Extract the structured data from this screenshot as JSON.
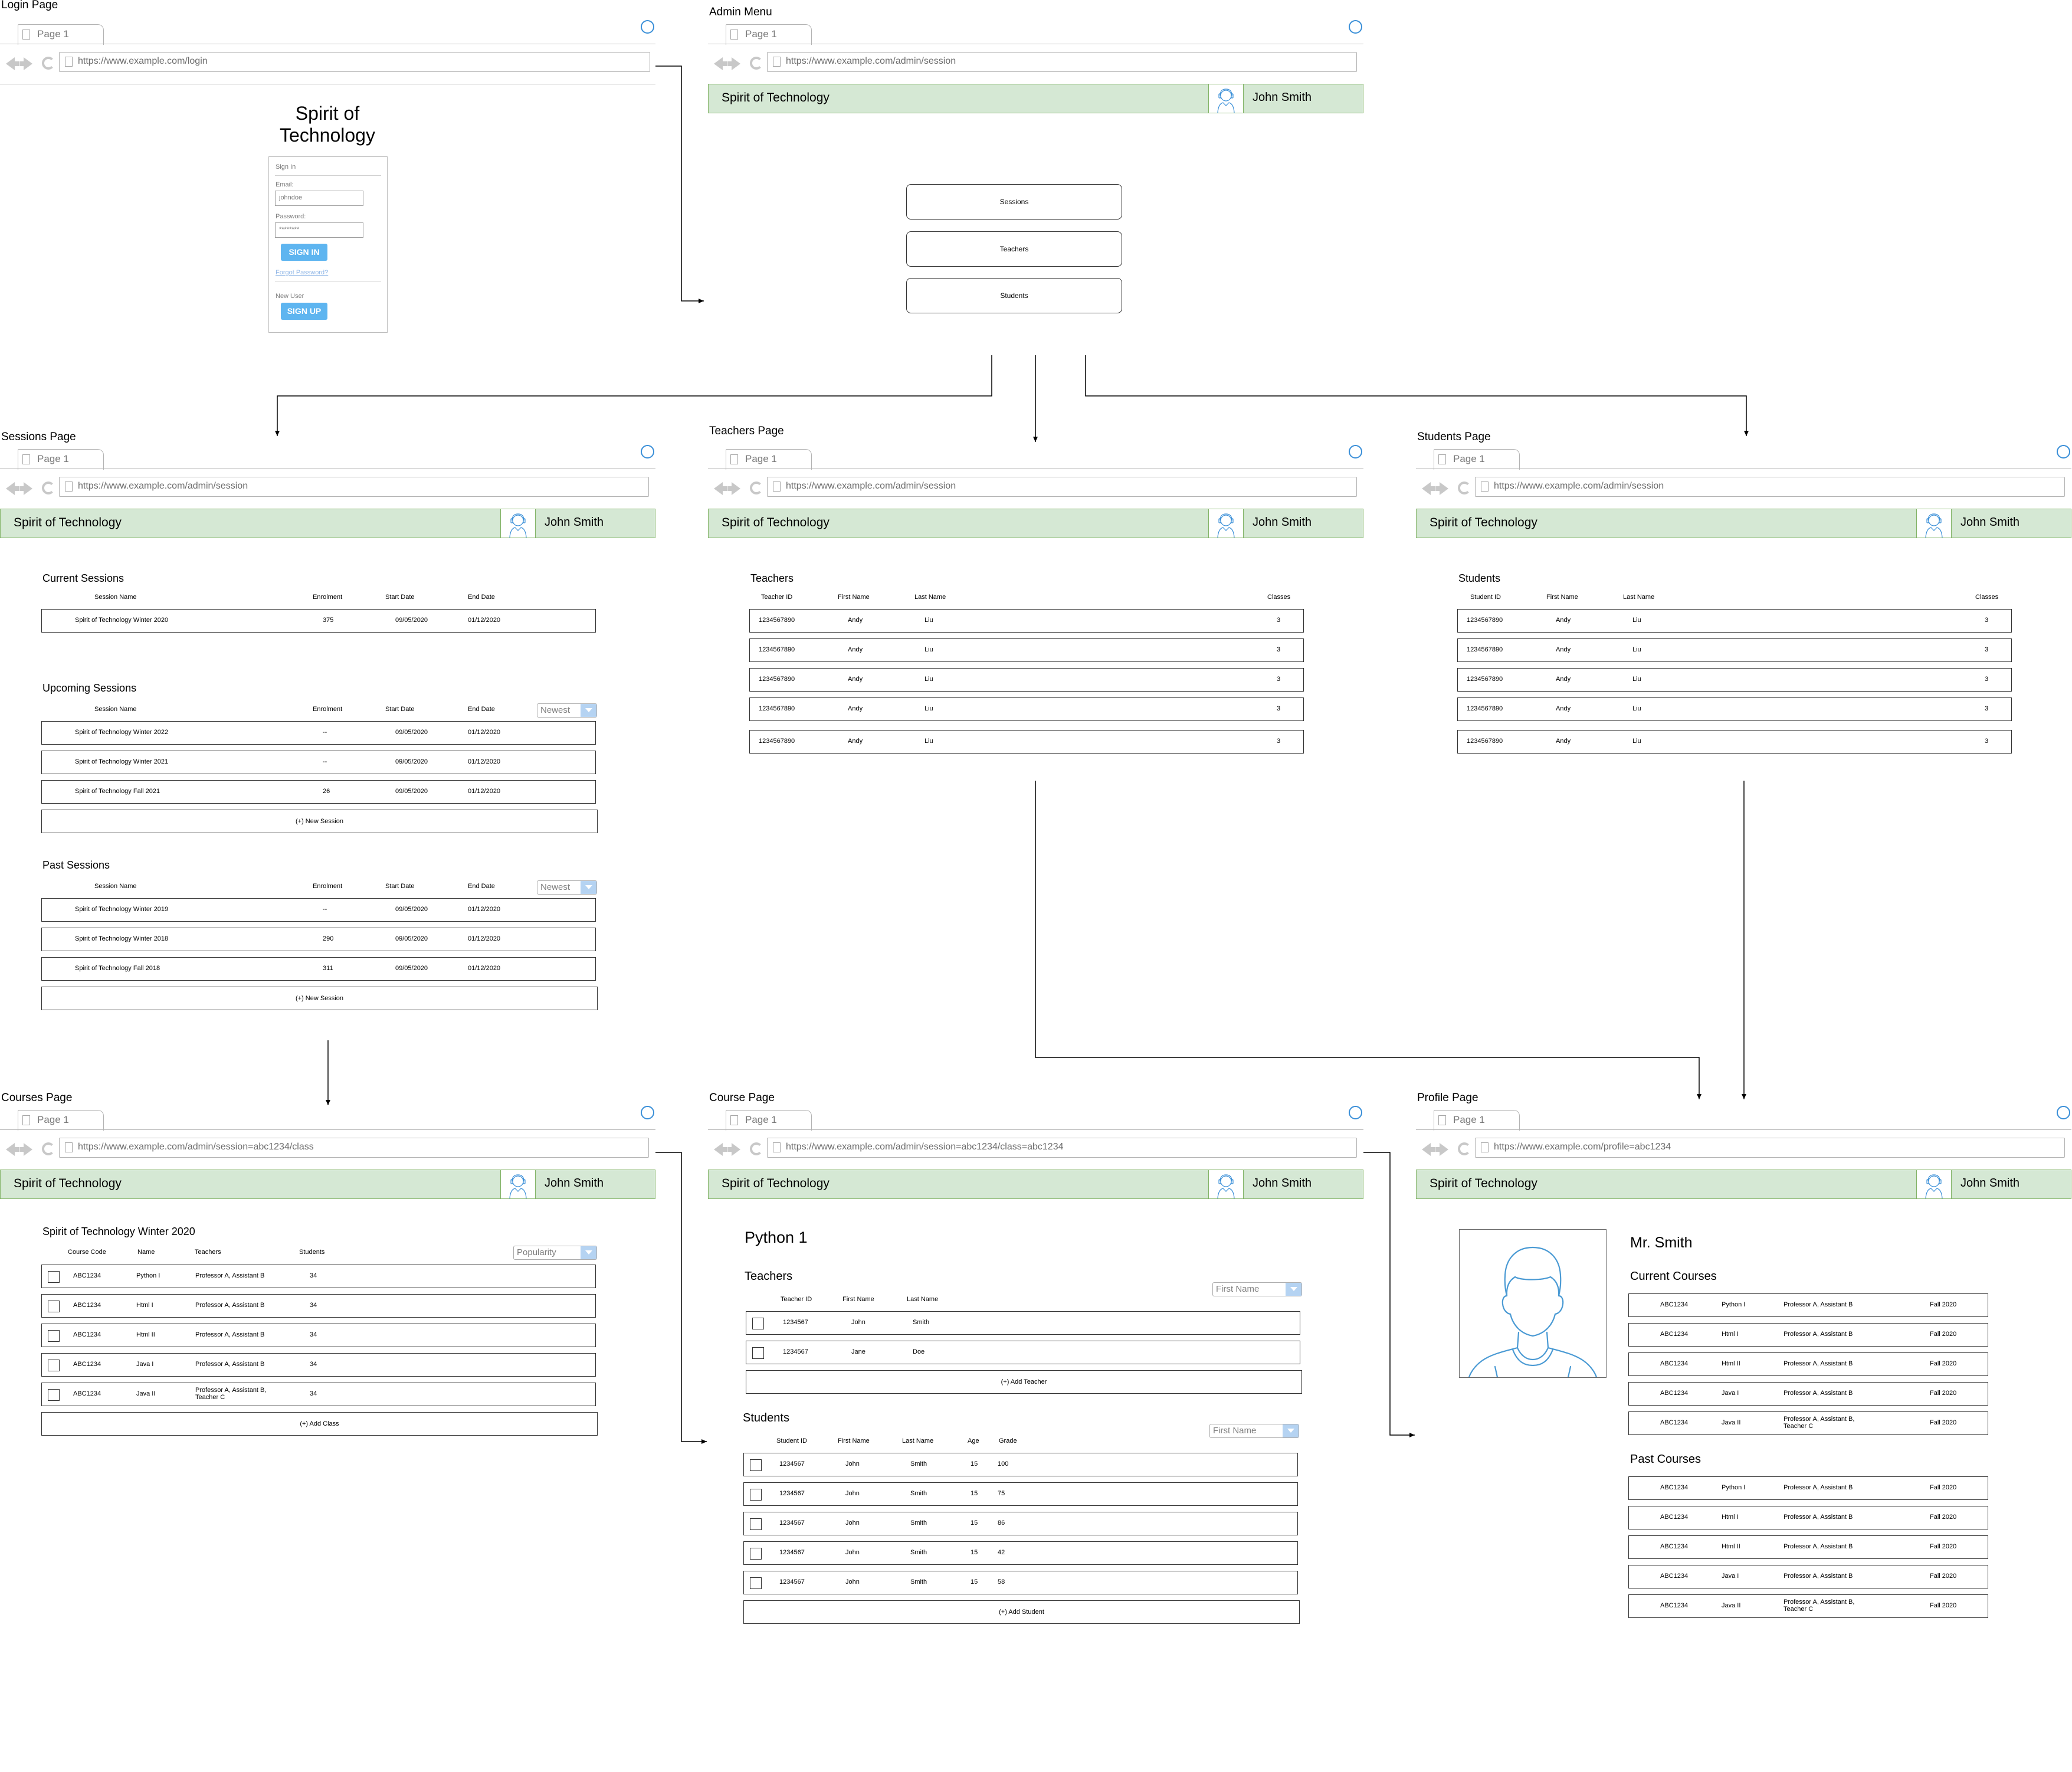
{
  "common": {
    "tab_label": "Page 1",
    "brand": "Spirit of Technology",
    "username": "John Smith",
    "colors": {
      "header_bg": "#d5e8d4",
      "header_border": "#82b366",
      "accent": "#5eb5f0",
      "link": "#8fb6e6",
      "circle": "#3a8fd8"
    }
  },
  "pages": {
    "login": {
      "title": "Login Page",
      "url": "https://www.example.com/login"
    },
    "admin_menu": {
      "title": "Admin Menu",
      "url": "https://www.example.com/admin/session"
    },
    "sessions": {
      "title": "Sessions Page",
      "url": "https://www.example.com/admin/session"
    },
    "teachers": {
      "title": "Teachers Page",
      "url": "https://www.example.com/admin/session"
    },
    "students": {
      "title": "Students Page",
      "url": "https://www.example.com/admin/session"
    },
    "courses": {
      "title": "Courses Page",
      "url": "https://www.example.com/admin/session=abc1234/class"
    },
    "course": {
      "title": "Course Page",
      "url": "https://www.example.com/admin/session=abc1234/class=abc1234"
    },
    "profile": {
      "title": "Profile Page",
      "url": "https://www.example.com/profile=abc1234"
    }
  },
  "login_form": {
    "heading_line1": "Spirit of",
    "heading_line2": "Technology",
    "sign_in_label": "Sign In",
    "email_label": "Email:",
    "email_value": "johndoe",
    "password_label": "Password:",
    "password_value": "********",
    "sign_in_button": "SIGN IN",
    "forgot_link": "Forgot Password?",
    "new_user_label": "New User",
    "sign_up_button": "SIGN UP"
  },
  "admin_menu": {
    "items": [
      "Sessions",
      "Teachers",
      "Students"
    ]
  },
  "sessions": {
    "current_title": "Current Sessions",
    "upcoming_title": "Upcoming Sessions",
    "past_title": "Past Sessions",
    "columns": [
      "Session Name",
      "Enrolment",
      "Start Date",
      "End Date"
    ],
    "sort_label": "Newest",
    "add_label": "(+) New Session",
    "current": [
      [
        "Spirit of Technology Winter 2020",
        "375",
        "09/05/2020",
        "01/12/2020"
      ]
    ],
    "upcoming": [
      [
        "Spirit of Technology Winter 2022",
        "--",
        "09/05/2020",
        "01/12/2020"
      ],
      [
        "Spirit of Technology Winter 2021",
        "--",
        "09/05/2020",
        "01/12/2020"
      ],
      [
        "Spirit of Technology Fall 2021",
        "26",
        "09/05/2020",
        "01/12/2020"
      ]
    ],
    "past": [
      [
        "Spirit of Technology Winter 2019",
        "--",
        "09/05/2020",
        "01/12/2020"
      ],
      [
        "Spirit of Technology Winter 2018",
        "290",
        "09/05/2020",
        "01/12/2020"
      ],
      [
        "Spirit of Technology Fall 2018",
        "311",
        "09/05/2020",
        "01/12/2020"
      ]
    ]
  },
  "teachers": {
    "section_title": "Teachers",
    "columns": [
      "Teacher ID",
      "First Name",
      "Last Name",
      "Classes"
    ],
    "rows": [
      [
        "1234567890",
        "Andy",
        "Liu",
        "3"
      ],
      [
        "1234567890",
        "Andy",
        "Liu",
        "3"
      ],
      [
        "1234567890",
        "Andy",
        "Liu",
        "3"
      ],
      [
        "1234567890",
        "Andy",
        "Liu",
        "3"
      ],
      [
        "1234567890",
        "Andy",
        "Liu",
        "3"
      ]
    ]
  },
  "students": {
    "section_title": "Students",
    "columns": [
      "Student ID",
      "First Name",
      "Last Name",
      "Classes"
    ],
    "rows": [
      [
        "1234567890",
        "Andy",
        "Liu",
        "3"
      ],
      [
        "1234567890",
        "Andy",
        "Liu",
        "3"
      ],
      [
        "1234567890",
        "Andy",
        "Liu",
        "3"
      ],
      [
        "1234567890",
        "Andy",
        "Liu",
        "3"
      ],
      [
        "1234567890",
        "Andy",
        "Liu",
        "3"
      ]
    ]
  },
  "courses": {
    "section_title": "Spirit of Technology Winter 2020",
    "columns": [
      "Course Code",
      "Name",
      "Teachers",
      "Students"
    ],
    "sort_label": "Popularity",
    "add_label": "(+) Add Class",
    "rows": [
      [
        "ABC1234",
        "Python I",
        "Professor A, Assistant B",
        "",
        "34"
      ],
      [
        "ABC1234",
        "Html I",
        "Professor A, Assistant B",
        "",
        "34"
      ],
      [
        "ABC1234",
        "Html II",
        "Professor A, Assistant B",
        "",
        "34"
      ],
      [
        "ABC1234",
        "Java I",
        "Professor A, Assistant B",
        "",
        "34"
      ],
      [
        "ABC1234",
        "Java II",
        "Professor A, Assistant B,",
        "Teacher C",
        "34"
      ]
    ]
  },
  "course": {
    "course_title": "Python 1",
    "teachers_title": "Teachers",
    "teacher_columns": [
      "Teacher ID",
      "First Name",
      "Last Name"
    ],
    "teacher_sort": "First Name",
    "teachers": [
      [
        "1234567",
        "John",
        "Smith"
      ],
      [
        "1234567",
        "Jane",
        "Doe"
      ]
    ],
    "add_teacher": "(+) Add Teacher",
    "students_title": "Students",
    "student_columns": [
      "Student ID",
      "First Name",
      "Last Name",
      "Age",
      "Grade"
    ],
    "student_sort": "First Name",
    "students": [
      [
        "1234567",
        "John",
        "Smith",
        "15",
        "100"
      ],
      [
        "1234567",
        "John",
        "Smith",
        "15",
        "75"
      ],
      [
        "1234567",
        "John",
        "Smith",
        "15",
        "86"
      ],
      [
        "1234567",
        "John",
        "Smith",
        "15",
        "42"
      ],
      [
        "1234567",
        "John",
        "Smith",
        "15",
        "58"
      ]
    ],
    "add_student": "(+) Add Student"
  },
  "profile": {
    "name": "Mr. Smith",
    "current_title": "Current Courses",
    "past_title": "Past Courses",
    "current": [
      [
        "ABC1234",
        "Python I",
        "Professor A, Assistant B",
        "",
        "Fall 2020"
      ],
      [
        "ABC1234",
        "Html I",
        "Professor A, Assistant B",
        "",
        "Fall 2020"
      ],
      [
        "ABC1234",
        "Html II",
        "Professor A, Assistant B",
        "",
        "Fall 2020"
      ],
      [
        "ABC1234",
        "Java I",
        "Professor A, Assistant B",
        "",
        "Fall 2020"
      ],
      [
        "ABC1234",
        "Java II",
        "Professor A, Assistant B,",
        "Teacher C",
        "Fall 2020"
      ]
    ],
    "past": [
      [
        "ABC1234",
        "Python I",
        "Professor A, Assistant B",
        "",
        "Fall 2020"
      ],
      [
        "ABC1234",
        "Html I",
        "Professor A, Assistant B",
        "",
        "Fall 2020"
      ],
      [
        "ABC1234",
        "Html II",
        "Professor A, Assistant B",
        "",
        "Fall 2020"
      ],
      [
        "ABC1234",
        "Java I",
        "Professor A, Assistant B",
        "",
        "Fall 2020"
      ],
      [
        "ABC1234",
        "Java II",
        "Professor A, Assistant B,",
        "Teacher C",
        "Fall 2020"
      ]
    ]
  }
}
